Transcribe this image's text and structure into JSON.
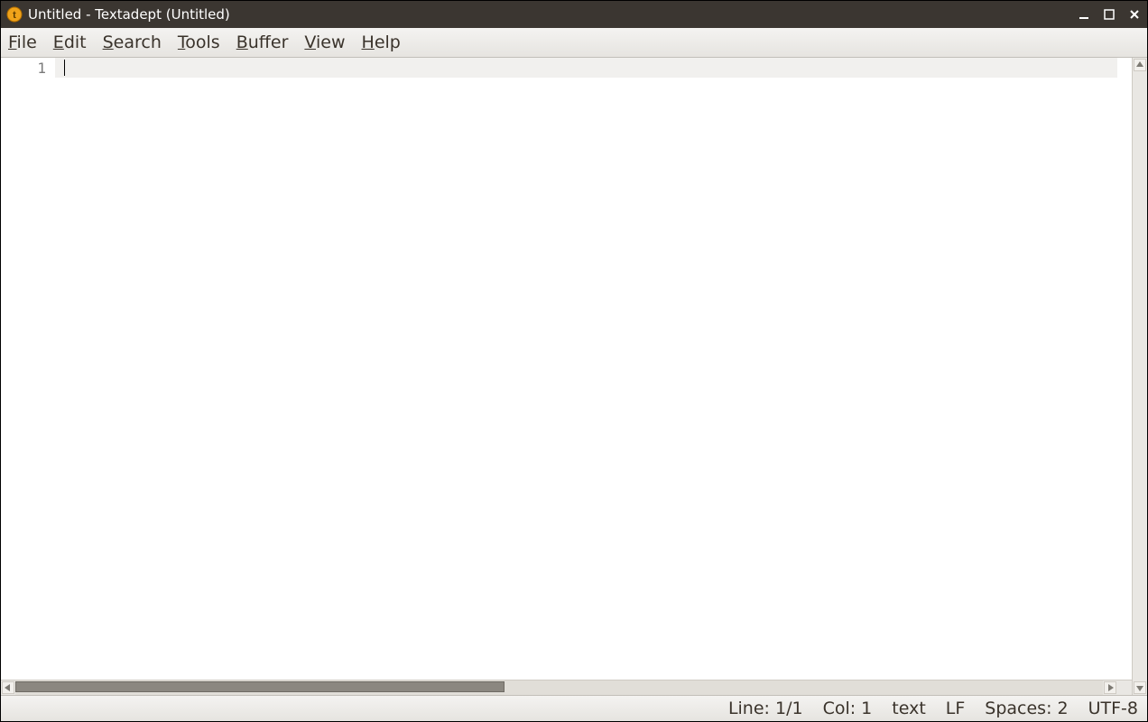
{
  "window": {
    "title": "Untitled - Textadept (Untitled)"
  },
  "menubar": {
    "file": "File",
    "edit": "Edit",
    "search": "Search",
    "tools": "Tools",
    "buffer": "Buffer",
    "view": "View",
    "help": "Help"
  },
  "editor": {
    "line_number_1": "1",
    "content_line_1": ""
  },
  "statusbar": {
    "line_col": "Line: 1/1",
    "col": "Col: 1",
    "lexer": "text",
    "eol": "LF",
    "indent": "Spaces: 2",
    "encoding": "UTF-8"
  }
}
